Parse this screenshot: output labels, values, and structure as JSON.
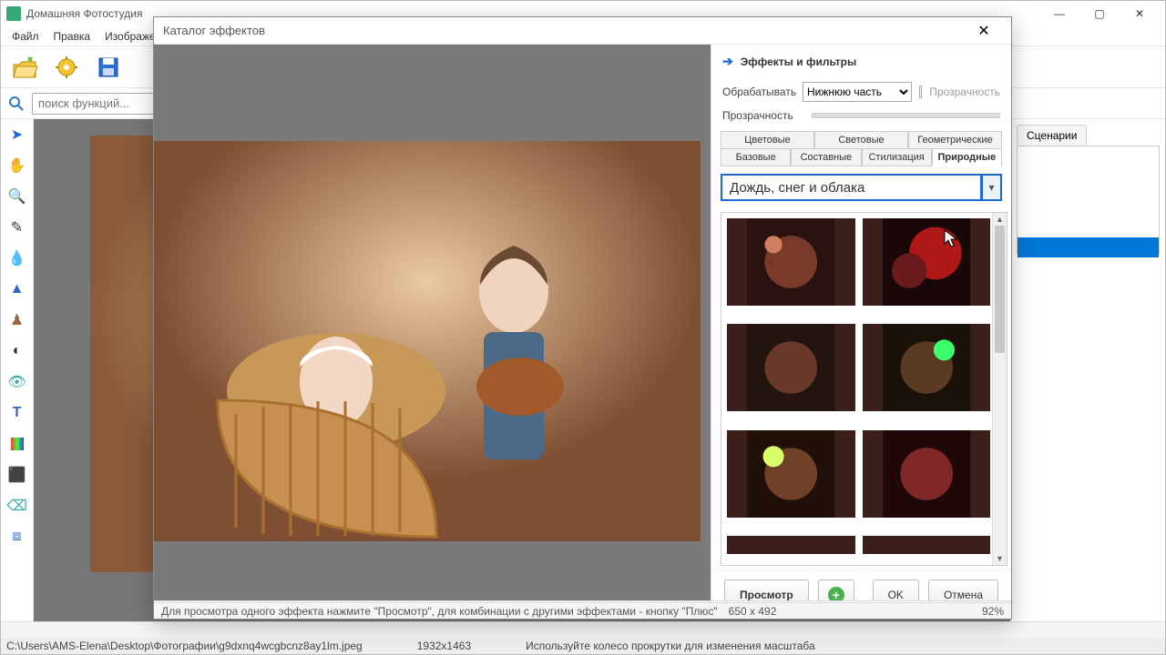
{
  "appTitle": "Домашняя Фотостудия",
  "menu": {
    "file": "Файл",
    "edit": "Правка",
    "image": "Изображени"
  },
  "searchPlaceholder": "поиск функций...",
  "rightTab": "Сценарии",
  "dialog": {
    "title": "Каталог эффектов",
    "sectionTitle": "Эффекты и фильтры",
    "processLabel": "Обрабатывать",
    "processValue": "Нижнюю часть",
    "transparencyCheck": "Прозрачность",
    "opacityLabel": "Прозрачность",
    "tabs": {
      "row1": {
        "a": "Цветовые",
        "b": "Световые",
        "c": "Геометрические"
      },
      "row2": {
        "a": "Базовые",
        "b": "Составные",
        "c": "Стилизация",
        "d": "Природные"
      }
    },
    "filterGroup": "Дождь, снег и облака",
    "actions": {
      "preview": "Просмотр",
      "ok": "OK",
      "cancel": "Отмена"
    },
    "statusHint": "Для просмотра одного эффекта нажмите \"Просмотр\", для комбинации с другими эффектами - кнопку \"Плюс\"",
    "statusSize": "650 x 492",
    "statusZoom": "92%"
  },
  "status2": {
    "path": "C:\\Users\\AMS-Elena\\Desktop\\Фотографии\\g9dxnq4wcgbcnz8ay1lm.jpeg",
    "dims": "1932x1463",
    "hint": "Используйте колесо прокрутки для изменения масштаба"
  }
}
